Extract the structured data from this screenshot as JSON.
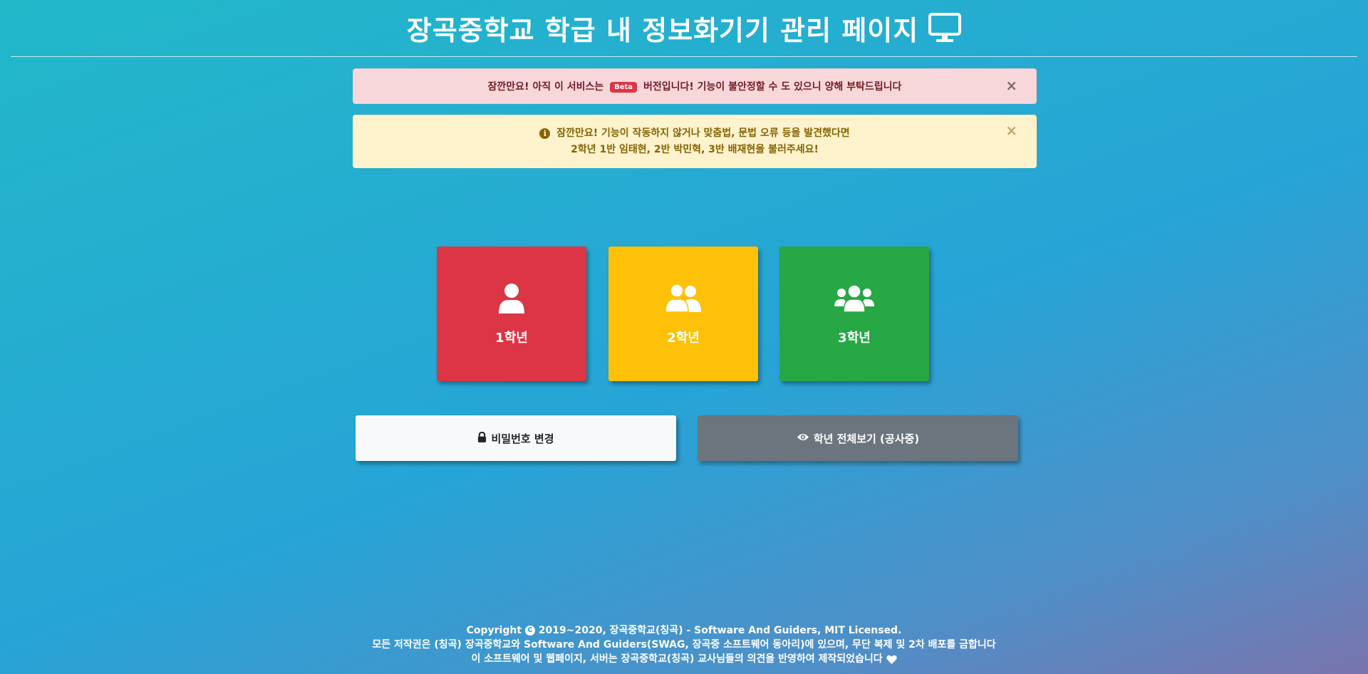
{
  "header": {
    "title": "장곡중학교 학급 내 정보화기기 관리 페이지",
    "icon": "desktop-monitor-icon"
  },
  "alerts": {
    "beta": {
      "strong": "잠깐만요!",
      "text_before": "아직 이 서비스는",
      "badge": "Beta",
      "text_after": "버전입니다! 기능이 불안정할 수 도 있으니 양해 부탁드립니다",
      "close": "×"
    },
    "report": {
      "strong": "잠깐만요!",
      "line1": "기능이 작동하지 않거나 맞춤법, 문법 오류 등을 발견했다면",
      "line2": "2학년 1반 임태현, 2반 박민혁, 3반 배재현을 불러주세요!",
      "close": "×"
    }
  },
  "grades": [
    {
      "label": "1학년",
      "icon": "user-icon",
      "color": "#dc3545"
    },
    {
      "label": "2학년",
      "icon": "user-friends-icon",
      "color": "#ffc107"
    },
    {
      "label": "3학년",
      "icon": "users-icon",
      "color": "#28a745"
    }
  ],
  "buttons": {
    "change_password": {
      "label": "비밀번호 변경",
      "icon": "lock-icon"
    },
    "view_all": {
      "label": "학년 전체보기 (공사중)",
      "icon": "eye-icon"
    }
  },
  "footer": {
    "line1_prefix": "Copyright",
    "line1_suffix": "2019~2020, 장곡중학교(칭곡) - Software And Guiders, MIT Licensed.",
    "line2": "모든 저작권은 (칭곡) 장곡중학교와 Software And Guiders(SWAG, 장곡중 소프트웨어 동아리)에 있으며, 무단 복제 및 2차 배포를 금합니다",
    "line3": "이 소프트웨어 및 웹페이지, 서버는 장곡중학교(칭곡) 교사님들의 의견을 반영하여 제작되었습니다"
  }
}
